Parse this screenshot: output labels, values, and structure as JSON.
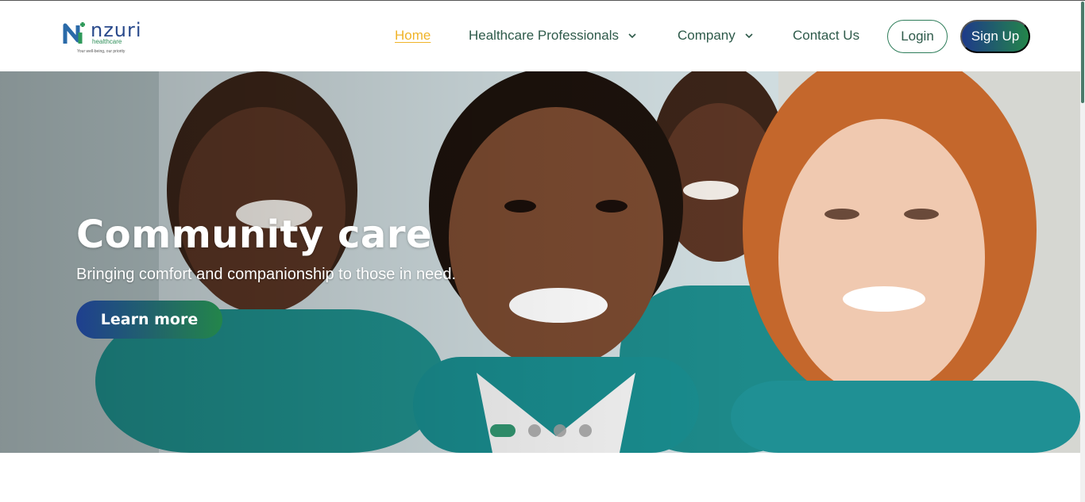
{
  "brand": {
    "name": "nzuri",
    "sub": "healthcare",
    "tagline": "Your well-being, our priority"
  },
  "nav": {
    "home": "Home",
    "healthcare_professionals": "Healthcare Professionals",
    "company": "Company",
    "contact": "Contact Us"
  },
  "auth": {
    "login": "Login",
    "signup": "Sign Up"
  },
  "hero": {
    "title": "Community care",
    "subtitle": "Bringing comfort and companionship to those in need.",
    "cta": "Learn more",
    "slides_total": 4,
    "active_slide": 1
  },
  "colors": {
    "accent_gold": "#f0b429",
    "brand_blue": "#1e3a8a",
    "brand_green": "#23854a",
    "nav_text": "#2e5a4a"
  }
}
